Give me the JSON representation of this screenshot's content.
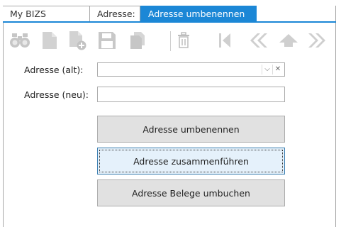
{
  "tabs": [
    {
      "label": "My BIZS"
    },
    {
      "label": "Adresse:"
    },
    {
      "label": "Adresse umbenennen",
      "close": "×"
    }
  ],
  "toolbar": {
    "icons": [
      "binoculars-icon",
      "new-document-icon",
      "add-document-icon",
      "save-icon",
      "copy-document-icon",
      "delete-icon",
      "first-record-icon",
      "previous-record-icon",
      "up-icon",
      "next-record-icon"
    ]
  },
  "form": {
    "old_address_label": "Adresse (alt):",
    "old_address_value": "",
    "new_address_label": "Adresse (neu):",
    "new_address_value": ""
  },
  "buttons": {
    "rename": "Adresse umbenennen",
    "merge": "Adresse zusammenführen",
    "rebook": "Adresse Belege umbuchen"
  },
  "colors": {
    "accent": "#1b87d6",
    "icon_gray": "#c8c8c8"
  }
}
